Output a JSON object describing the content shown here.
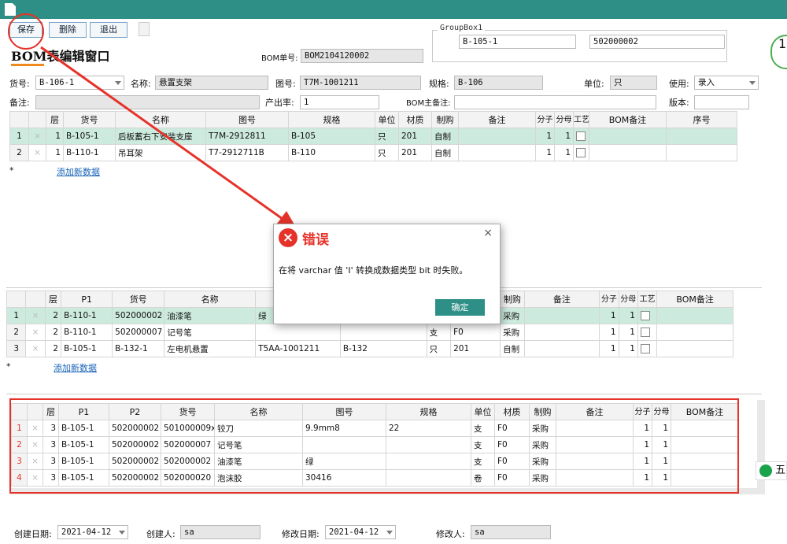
{
  "toolbar": {
    "save": "保存",
    "delete": "删除",
    "exit": "退出"
  },
  "window_title": "BOM表编辑窗口",
  "groupbox": {
    "title": "GroupBox1",
    "field1": "B-105-1",
    "field2": "502000002"
  },
  "header": {
    "bom_no_label": "BOM单号:",
    "bom_no": "BOM2104120002",
    "item_no_label": "货号:",
    "item_no": "B-106-1",
    "name_label": "名称:",
    "name": "悬置支架",
    "drawing_label": "图号:",
    "drawing": "T7M-1001211",
    "spec_label": "规格:",
    "spec": "B-106",
    "unit_label": "单位:",
    "unit": "只",
    "use_label": "使用:",
    "use": "录入",
    "remark_label": "备注:",
    "remark": "",
    "yield_label": "产出率:",
    "yield": "1",
    "bom_remark_label": "BOM主备注:",
    "bom_remark": "",
    "version_label": "版本:",
    "version": ""
  },
  "grid1": {
    "columns": [
      "",
      "",
      "层",
      "货号",
      "名称",
      "图号",
      "规格",
      "单位",
      "材质",
      "制购",
      "备注",
      "分子",
      "分母",
      "工艺",
      "BOM备注",
      "序号"
    ],
    "rows": [
      [
        "1",
        "×",
        "1",
        "B-105-1",
        "后板蓄右下安装支座",
        "T7M-2912811",
        "B-105",
        "只",
        "201",
        "自制",
        "",
        "1",
        "1",
        "",
        "",
        ""
      ],
      [
        "2",
        "×",
        "1",
        "B-110-1",
        "吊耳架",
        "T7-2912711B",
        "B-110",
        "只",
        "201",
        "自制",
        "",
        "1",
        "1",
        "",
        "",
        ""
      ]
    ],
    "add_star": "*",
    "add_link": "添加新数据"
  },
  "grid2": {
    "columns": [
      "",
      "",
      "层",
      "P1",
      "货号",
      "名称",
      "",
      "",
      "",
      "",
      "制购",
      "备注",
      "分子",
      "分母",
      "工艺",
      "BOM备注"
    ],
    "rows": [
      [
        "1",
        "×",
        "2",
        "B-110-1",
        "502000002",
        "油漆笔",
        "绿",
        "",
        "",
        "",
        "采购",
        "",
        "1",
        "1",
        ""
      ],
      [
        "2",
        "×",
        "2",
        "B-110-1",
        "502000007",
        "记号笔",
        "",
        "",
        "支",
        "F0",
        "采购",
        "",
        "1",
        "1",
        ""
      ],
      [
        "3",
        "×",
        "2",
        "B-105-1",
        "B-132-1",
        "左电机悬置",
        "T5AA-1001211",
        "B-132",
        "只",
        "201",
        "自制",
        "",
        "1",
        "1",
        ""
      ]
    ],
    "add_star": "*",
    "add_link": "添加新数据"
  },
  "grid3": {
    "columns": [
      "",
      "",
      "层",
      "P1",
      "P2",
      "货号",
      "名称",
      "图号",
      "规格",
      "单位",
      "材质",
      "制购",
      "备注",
      "分子",
      "分母",
      "BOM备注"
    ],
    "rows": [
      [
        "1",
        "×",
        "3",
        "B-105-1",
        "502000002",
        "501000009x",
        "铰刀",
        "9.9mm8",
        "22",
        "支",
        "F0",
        "采购",
        "",
        "1",
        "1",
        ""
      ],
      [
        "2",
        "×",
        "3",
        "B-105-1",
        "502000002",
        "502000007",
        "记号笔",
        "",
        "",
        "支",
        "F0",
        "采购",
        "",
        "1",
        "1",
        ""
      ],
      [
        "3",
        "×",
        "3",
        "B-105-1",
        "502000002",
        "502000002",
        "油漆笔",
        "绿",
        "",
        "支",
        "F0",
        "采购",
        "",
        "1",
        "1",
        ""
      ],
      [
        "4",
        "×",
        "3",
        "B-105-1",
        "502000002",
        "502000020",
        "泡沫胶",
        "30416",
        "",
        "卷",
        "F0",
        "采购",
        "",
        "1",
        "1",
        ""
      ]
    ]
  },
  "footer": {
    "created_date_label": "创建日期:",
    "created_date": "2021-04-12",
    "creator_label": "创建人:",
    "creator": "sa",
    "modified_date_label": "修改日期:",
    "modified_date": "2021-04-12",
    "modifier_label": "修改人:",
    "modifier": "sa"
  },
  "dialog": {
    "icon": "error-x-icon",
    "title": "错误",
    "close": "×",
    "message": "在将 varchar 值 'I' 转换成数据类型 bit 时失败。",
    "ok": "确定"
  },
  "side": {
    "badge_top": "1",
    "ime": "五"
  },
  "colors": {
    "titlebar": "#2e8f86",
    "selected_row": "#cdeade",
    "annotation_red": "#e5332a",
    "link": "#1a64b8"
  }
}
